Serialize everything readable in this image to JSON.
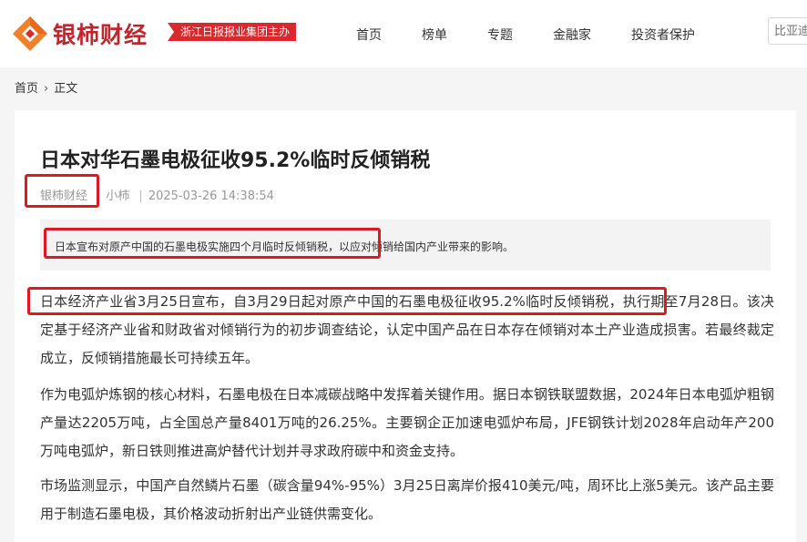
{
  "header": {
    "brand": "银柿财经",
    "tagline": "浙江日报报业集团主办",
    "nav": [
      "首页",
      "榜单",
      "专题",
      "金融家",
      "投资者保护"
    ],
    "search": {
      "placeholder": "比亚迪"
    },
    "logo_colors": [
      "#f0802a",
      "#d9292c"
    ]
  },
  "breadcrumb": {
    "home": "首页",
    "current": "正文"
  },
  "article": {
    "title": "日本对华石墨电极征收95.2%临时反倾销税",
    "source": "银柿财经",
    "author": "小柿",
    "datetime": "2025-03-26 14:38:54",
    "summary": "日本宣布对原产中国的石墨电极实施四个月临时反倾销税，以应对倾销给国内产业带来的影响。",
    "paragraphs": [
      "日本经济产业省3月25日宣布，自3月29日起对原产中国的石墨电极征收95.2%临时反倾销税，执行期至7月28日。该决定基于经济产业省和财政省对倾销行为的初步调查结论，认定中国产品在日本存在倾销对本土产业造成损害。若最终裁定成立，反倾销措施最长可持续五年。",
      "作为电弧炉炼钢的核心材料，石墨电极在日本减碳战略中发挥着关键作用。据日本钢铁联盟数据，2024年日本电弧炉粗钢产量达2205万吨，占全国总产量8401万吨的26.25%。主要钢企正加速电弧炉布局，JFE钢铁计划2028年启动年产200万吨电弧炉，新日铁则推进高炉替代计划并寻求政府碳中和资金支持。",
      "市场监测显示，中国产自然鳞片石墨（碳含量94%-95%）3月25日离岸价报410美元/吨，周环比上涨5美元。该产品主要用于制造石墨电极，其价格波动折射出产业链供需变化。"
    ]
  },
  "highlight_color": "#e0191e"
}
